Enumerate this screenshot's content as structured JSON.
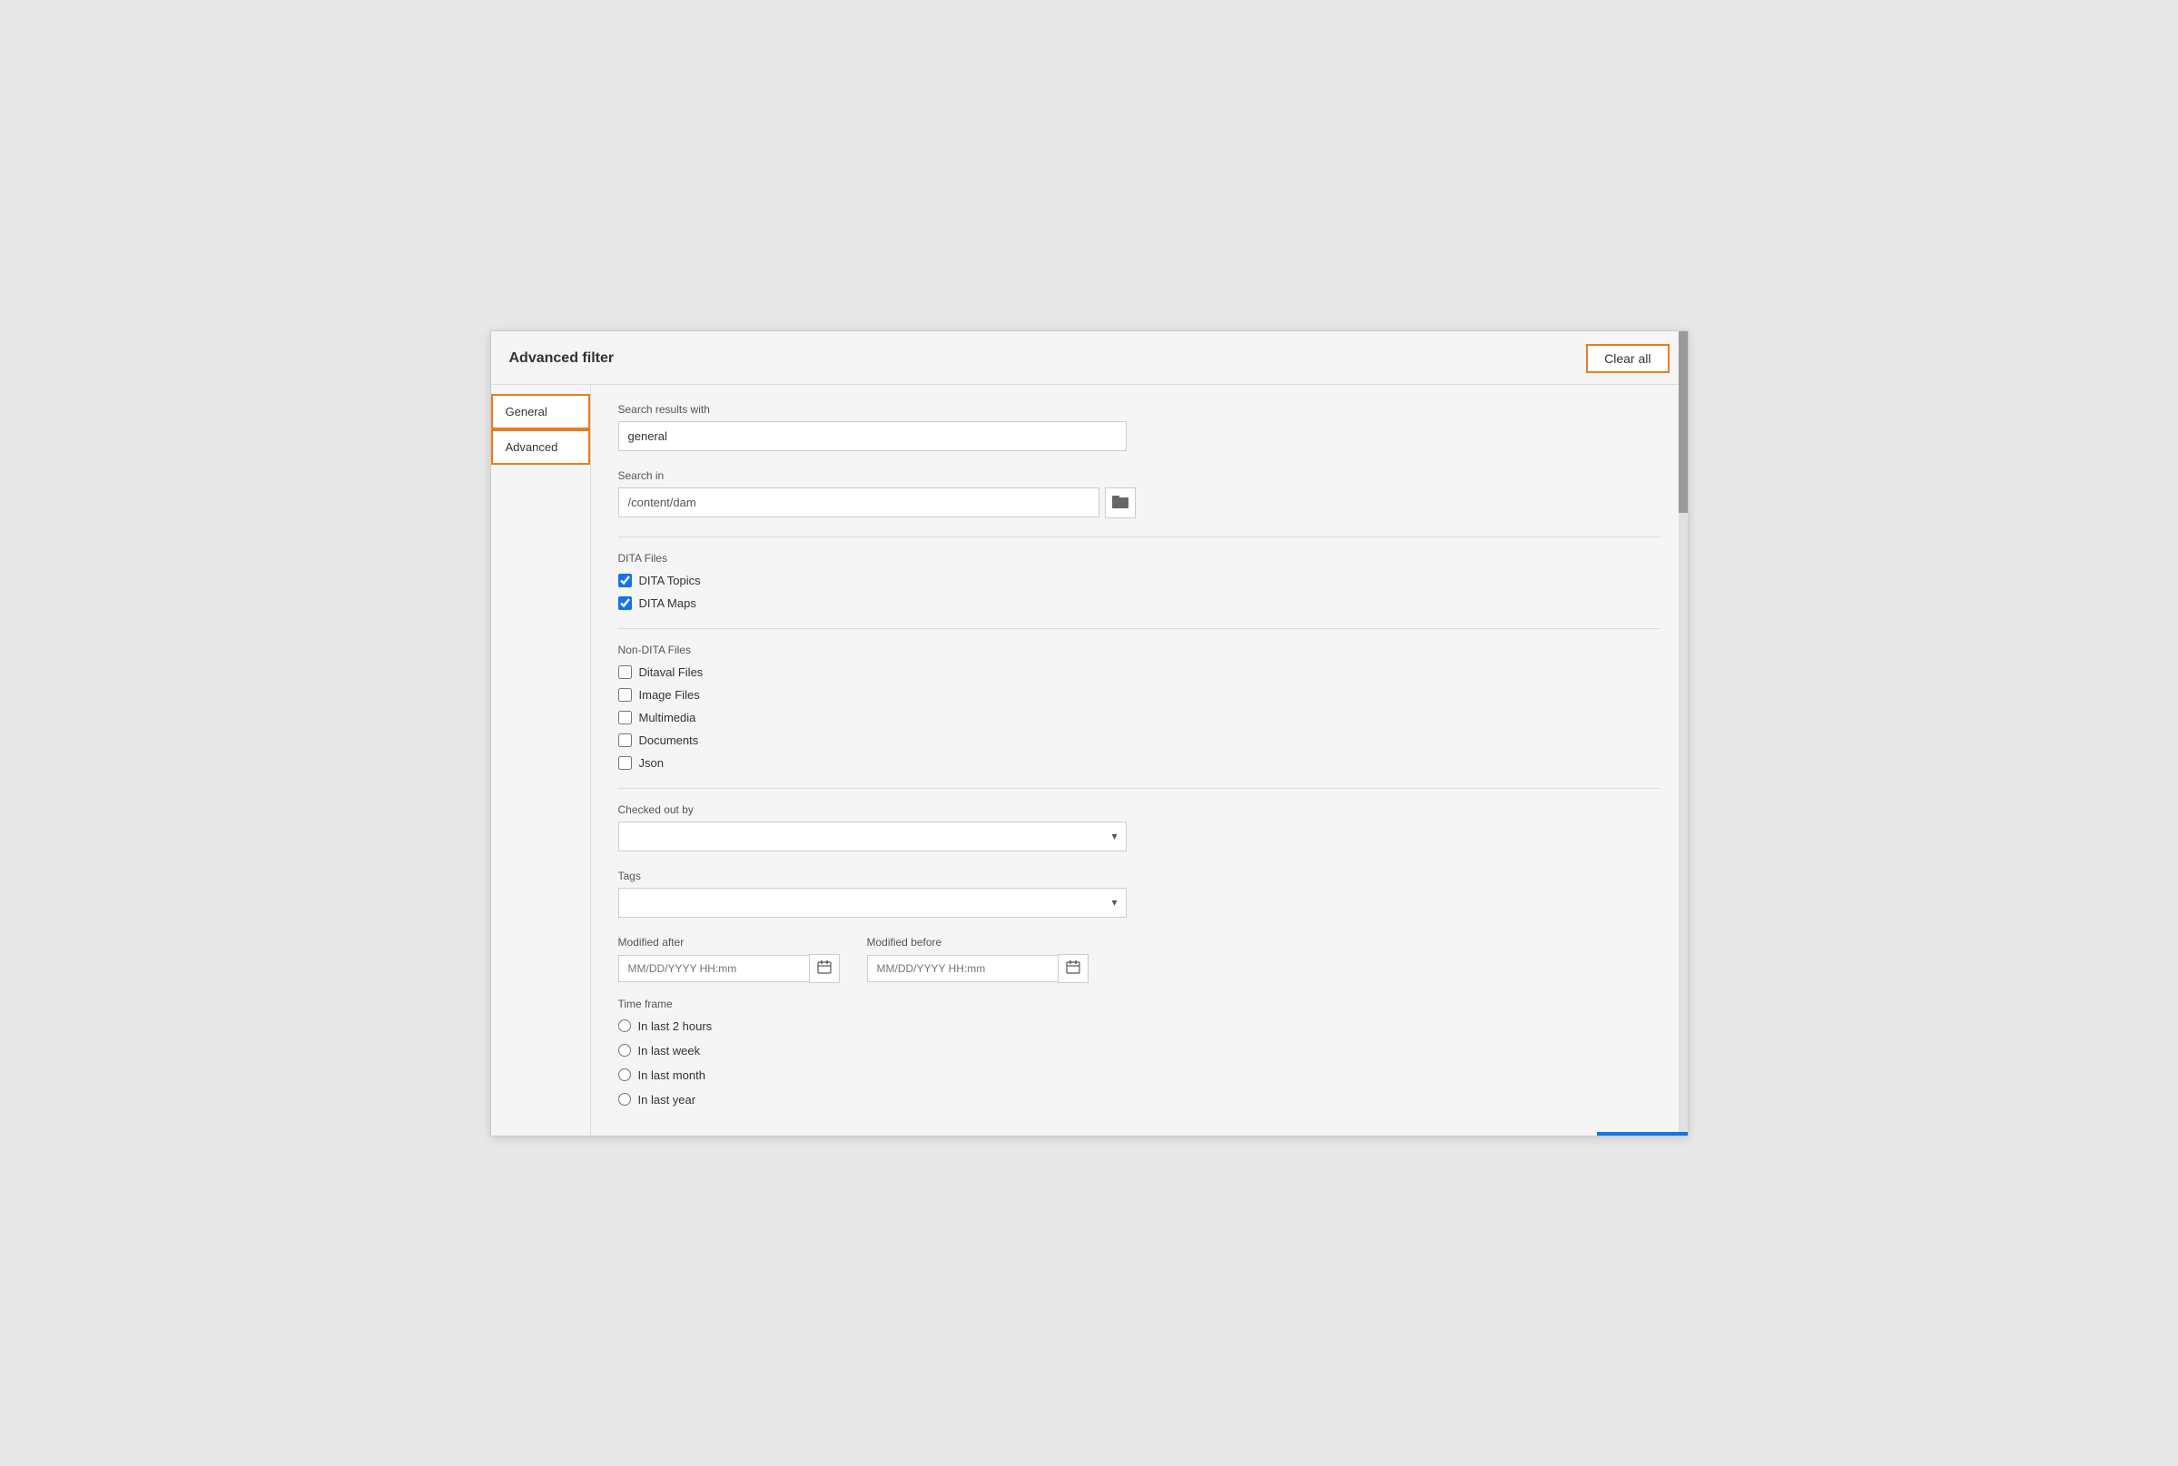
{
  "dialog": {
    "title": "Advanced filter",
    "clear_all_label": "Clear all"
  },
  "sidebar": {
    "items": [
      {
        "id": "general",
        "label": "General",
        "active": true
      },
      {
        "id": "advanced",
        "label": "Advanced",
        "active": true
      }
    ]
  },
  "main": {
    "search_results_with_label": "Search results with",
    "search_results_value": "general",
    "search_in_label": "Search in",
    "search_in_value": "/content/dam",
    "dita_files_label": "DITA Files",
    "dita_topics_label": "DITA Topics",
    "dita_topics_checked": true,
    "dita_maps_label": "DITA Maps",
    "dita_maps_checked": true,
    "non_dita_files_label": "Non-DITA Files",
    "ditaval_label": "Ditaval Files",
    "ditaval_checked": false,
    "image_label": "Image Files",
    "image_checked": false,
    "multimedia_label": "Multimedia",
    "multimedia_checked": false,
    "documents_label": "Documents",
    "documents_checked": false,
    "json_label": "Json",
    "json_checked": false,
    "checked_out_by_label": "Checked out by",
    "tags_label": "Tags",
    "modified_after_label": "Modified after",
    "modified_after_placeholder": "MM/DD/YYYY HH:mm",
    "modified_before_label": "Modified before",
    "modified_before_placeholder": "MM/DD/YYYY HH:mm",
    "time_frame_label": "Time frame",
    "time_frame_options": [
      {
        "id": "2hours",
        "label": "In last 2 hours"
      },
      {
        "id": "week",
        "label": "In last week"
      },
      {
        "id": "month",
        "label": "In last month"
      },
      {
        "id": "year",
        "label": "In last year"
      }
    ]
  },
  "icons": {
    "folder": "🗂",
    "calendar": "📅",
    "chevron_down": "▾"
  }
}
